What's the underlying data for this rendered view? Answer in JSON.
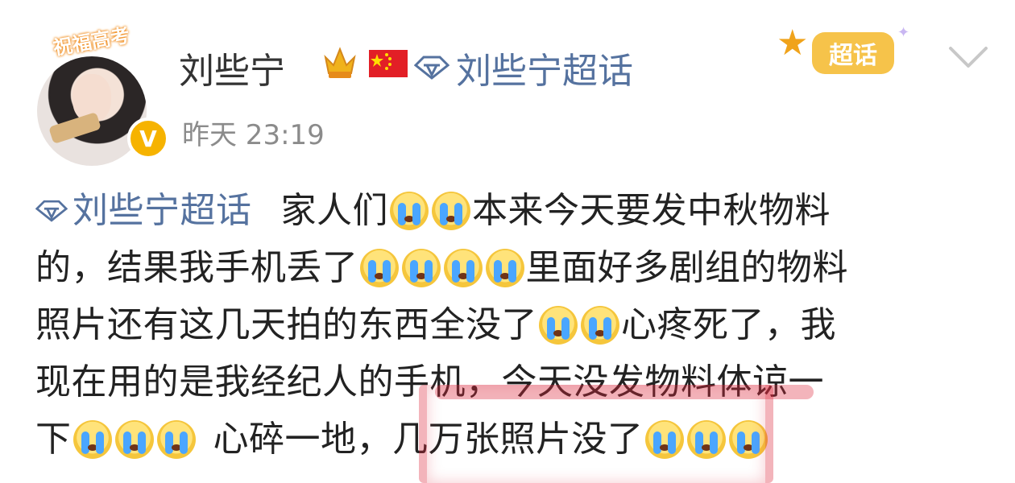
{
  "avatar": {
    "banner_text": "祝福高考"
  },
  "author": {
    "name": "刘些宁",
    "verified_badge": "V",
    "post_time": "昨天 23:19"
  },
  "topic_header": {
    "label": "刘些宁超话"
  },
  "supertopic_badge": {
    "label": "超话"
  },
  "icons": [
    "crown-icon",
    "china-flag-icon",
    "topic-diamond-icon",
    "star-icon",
    "sparkle-icon",
    "chevron-down-icon",
    "crying-emoji"
  ],
  "post": {
    "topic_tag": "刘些宁超话",
    "line1_text": "家人们",
    "line1_tail": "本来今天要发中秋物料",
    "line2_head": "的，结果我手机丢了",
    "line2_tail": "里面好多剧组的物料",
    "line3_head": "照片还有这几天拍的东西全没了",
    "line3_tail": "心疼死了，我",
    "line4": "现在用的是我经纪人的手机，今天没发物料体谅一",
    "line5_head": "下",
    "line5_mid": "心碎一地，",
    "line5_tail": "几万张照片没了"
  },
  "colors": {
    "topic_blue": "#55729f",
    "text": "#222222",
    "time_gray": "#8b8b8b",
    "badge_gold": "#f6c34a"
  }
}
